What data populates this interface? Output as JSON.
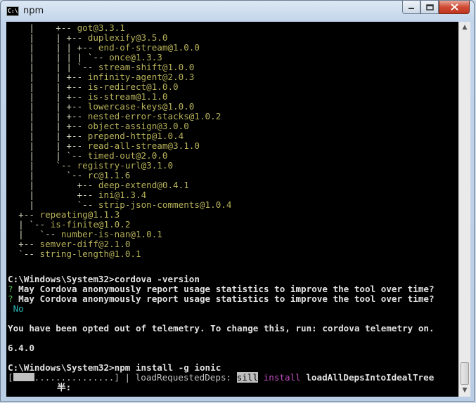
{
  "window": {
    "icon_label": "C:\\",
    "title": "npm",
    "minimize_icon": "minimize-icon",
    "maximize_icon": "maximize-icon",
    "close_icon": "close-icon"
  },
  "console": {
    "tree_lines": [
      {
        "prefix": "    |    +-- ",
        "pkg": "got@3.3.1"
      },
      {
        "prefix": "    |    | +-- ",
        "pkg": "duplexify@3.5.0"
      },
      {
        "prefix": "    |    | | +-- ",
        "pkg": "end-of-stream@1.0.0"
      },
      {
        "prefix": "    |    | | | `-- ",
        "pkg": "once@1.3.3"
      },
      {
        "prefix": "    |    | | `-- ",
        "pkg": "stream-shift@1.0.0"
      },
      {
        "prefix": "    |    | +-- ",
        "pkg": "infinity-agent@2.0.3"
      },
      {
        "prefix": "    |    | +-- ",
        "pkg": "is-redirect@1.0.0"
      },
      {
        "prefix": "    |    | +-- ",
        "pkg": "is-stream@1.1.0"
      },
      {
        "prefix": "    |    | +-- ",
        "pkg": "lowercase-keys@1.0.0"
      },
      {
        "prefix": "    |    | +-- ",
        "pkg": "nested-error-stacks@1.0.2"
      },
      {
        "prefix": "    |    | +-- ",
        "pkg": "object-assign@3.0.0"
      },
      {
        "prefix": "    |    | +-- ",
        "pkg": "prepend-http@1.0.4"
      },
      {
        "prefix": "    |    | +-- ",
        "pkg": "read-all-stream@3.1.0"
      },
      {
        "prefix": "    |    | `-- ",
        "pkg": "timed-out@2.0.0"
      },
      {
        "prefix": "    |    `-- ",
        "pkg": "registry-url@3.1.0"
      },
      {
        "prefix": "    |      `-- ",
        "pkg": "rc@1.1.6"
      },
      {
        "prefix": "    |        +-- ",
        "pkg": "deep-extend@0.4.1"
      },
      {
        "prefix": "    |        +-- ",
        "pkg": "ini@1.3.4"
      },
      {
        "prefix": "    |        `-- ",
        "pkg": "strip-json-comments@1.0.4"
      },
      {
        "prefix": "  +-- ",
        "pkg": "repeating@1.1.3"
      },
      {
        "prefix": "  | `-- ",
        "pkg": "is-finite@1.0.2"
      },
      {
        "prefix": "  |   `-- ",
        "pkg": "number-is-nan@1.0.1"
      },
      {
        "prefix": "  +-- ",
        "pkg": "semver-diff@2.1.0"
      },
      {
        "prefix": "  `-- ",
        "pkg": "string-length@1.0.1"
      }
    ],
    "prompt1": "C:\\Windows\\System32>cordova -version",
    "question_mark": "?",
    "question": " May Cordova anonymously report usage statistics to improve the tool over time?",
    "answer": " No",
    "telemetry_msg": "You have been opted out of telemetry. To change this, run: cordova telemetry on.",
    "version": "6.4.0",
    "prompt2": "C:\\Windows\\System32>npm install -g ionic",
    "progress_open": "[",
    "progress_dots": "...............",
    "progress_close": "] | loadRequestedDeps: ",
    "log_level": "sill",
    "log_cmd": "install",
    "log_msg": " loadAllDepsIntoIdealTree",
    "ime_status": "半:"
  },
  "scrollbar": {
    "up_icon": "▲",
    "down_icon": "▼"
  }
}
